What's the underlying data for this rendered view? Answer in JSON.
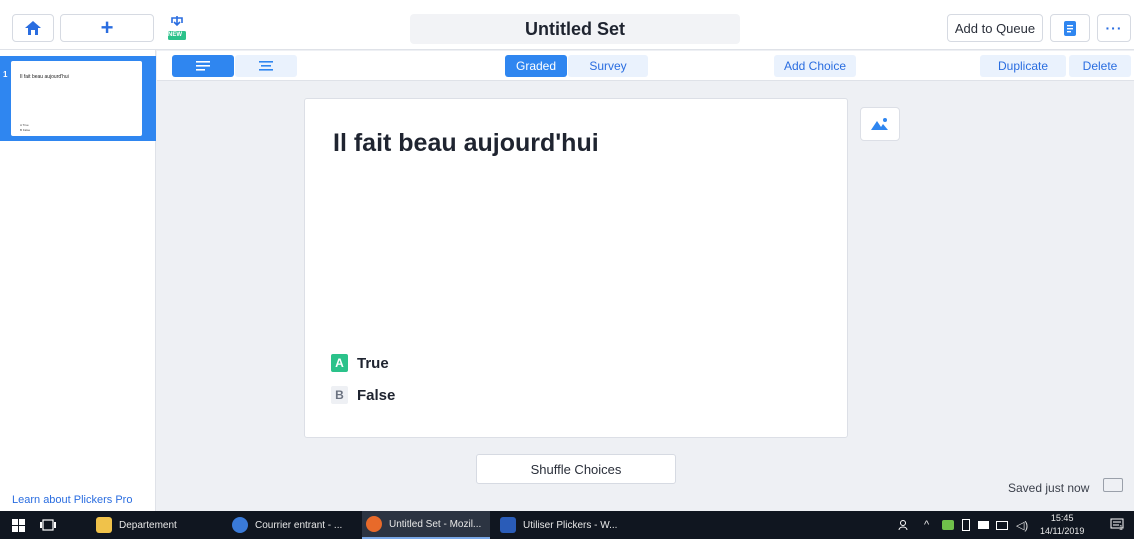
{
  "header": {
    "title": "Untitled Set",
    "new_badge": "NEW",
    "add_to_queue_label": "Add to Queue"
  },
  "toolbar": {
    "graded_label": "Graded",
    "survey_label": "Survey",
    "add_choice_label": "Add Choice",
    "duplicate_label": "Duplicate",
    "delete_label": "Delete"
  },
  "sidebar": {
    "slides": [
      {
        "number": "1",
        "question": "Il fait beau aujourd'hui",
        "choices": [
          "A True",
          "B False"
        ]
      }
    ],
    "learn_link": "Learn about Plickers Pro"
  },
  "question": {
    "text": "Il fait beau aujourd'hui",
    "choices": [
      {
        "letter": "A",
        "text": "True",
        "correct": true
      },
      {
        "letter": "B",
        "text": "False",
        "correct": false
      }
    ]
  },
  "footer": {
    "shuffle_label": "Shuffle Choices",
    "saved_status": "Saved just now"
  },
  "taskbar": {
    "apps": [
      {
        "label": "Departement",
        "icon": "folder-icon"
      },
      {
        "label": "Courrier entrant - ...",
        "icon": "mail-icon"
      },
      {
        "label": "Untitled Set - Mozil...",
        "icon": "firefox-icon"
      },
      {
        "label": "Utiliser Plickers - W...",
        "icon": "word-icon"
      }
    ],
    "time": "15:45",
    "date": "14/11/2019",
    "notification_count": "1"
  },
  "colors": {
    "accent": "#2f86f0",
    "correct": "#2bc28a",
    "taskbar": "#101620"
  }
}
